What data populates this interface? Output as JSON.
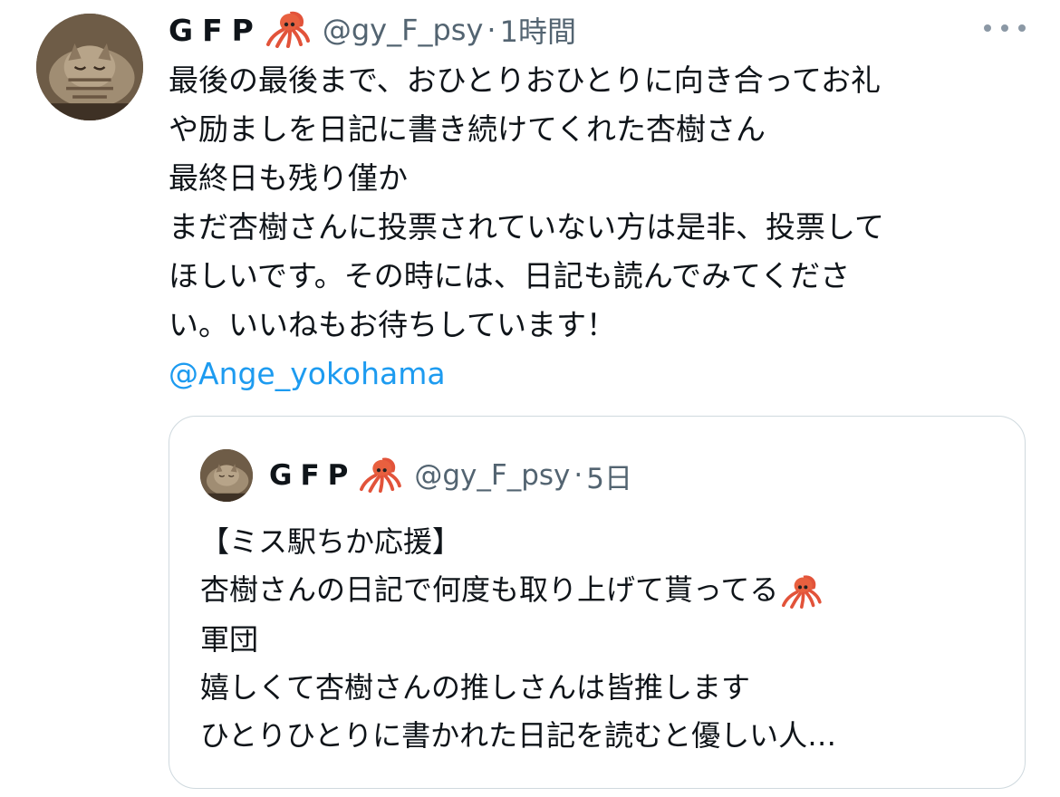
{
  "tweet": {
    "display_name": "GFP",
    "handle": "@gy_F_psy",
    "separator": "·",
    "time": "1時間",
    "body_lines": [
      "最後の最後まで、おひとりおひとりに向き合ってお礼",
      "や励ましを日記に書き続けてくれた杏樹さん",
      "最終日も残り僅か",
      "まだ杏樹さんに投票されていない方は是非、投票して",
      "ほしいです。その時には、日記も読んでみてくださ",
      "い。いいねもお待ちしています！"
    ],
    "mention": "@Ange_yokohama",
    "name_emoji_icon": "squid-icon",
    "more_icon": "more-dots-icon"
  },
  "quote": {
    "display_name": "GFP",
    "handle": "@gy_F_psy",
    "separator": "·",
    "time": "5日",
    "body_lines": [
      "【ミス駅ちか応援】",
      "杏樹さんの日記で何度も取り上げて貰ってる",
      "軍団",
      "嬉しくて杏樹さんの推しさんは皆推します",
      "ひとりひとりに書かれた日記を読むと優しい人…"
    ]
  },
  "colors": {
    "text": "#0f1419",
    "secondary": "#536471",
    "link": "#1d9bf0",
    "border": "#cfd9de"
  }
}
